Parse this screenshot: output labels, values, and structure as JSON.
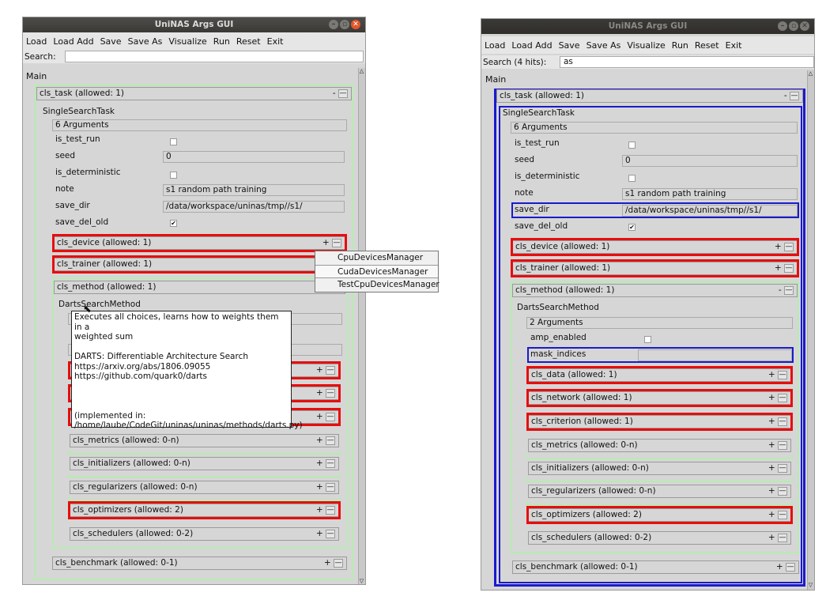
{
  "left": {
    "title": "UniNAS Args GUI",
    "menu": [
      "Load",
      "Load Add",
      "Save",
      "Save As",
      "Visualize",
      "Run",
      "Reset",
      "Exit"
    ],
    "search_label": "Search:",
    "search_value": "",
    "main_label": "Main",
    "cls_task": "cls_task (allowed: 1)",
    "task_name": "SingleSearchTask",
    "args_count": "6 Arguments",
    "args": [
      {
        "name": "is_test_run",
        "value": "",
        "type": "check",
        "checked": false
      },
      {
        "name": "seed",
        "value": "0",
        "type": "text"
      },
      {
        "name": "is_deterministic",
        "value": "",
        "type": "check",
        "checked": false
      },
      {
        "name": "note",
        "value": "s1 random path training",
        "type": "text"
      },
      {
        "name": "save_dir",
        "value": "/data/workspace/uninas/tmp//s1/",
        "type": "text"
      },
      {
        "name": "save_del_old",
        "value": "✔",
        "type": "check",
        "checked": true
      }
    ],
    "cls_device": "cls_device (allowed: 1)",
    "cls_trainer": "cls_trainer (allowed: 1)",
    "cls_method": "cls_method (allowed: 1)",
    "method_name": "DartsSearchMethod",
    "sub": [
      "cls_metrics (allowed: 0-n)",
      "cls_initializers (allowed: 0-n)",
      "cls_regularizers (allowed: 0-n)",
      "cls_optimizers (allowed: 2)",
      "cls_schedulers (allowed: 0-2)"
    ],
    "cls_benchmark": "cls_benchmark (allowed: 0-1)",
    "dropdown": [
      "CpuDevicesManager",
      "CudaDevicesManager",
      "TestCpuDevicesManager"
    ],
    "tooltip": [
      "Executes all choices, learns how to weights them in a",
      "weighted sum",
      "",
      "DARTS: Differentiable Architecture Search",
      "https://arxiv.org/abs/1806.09055",
      "https://github.com/quark0/darts",
      "",
      "",
      "",
      "(implemented in:",
      "/home/laube/CodeGit/uninas/uninas/methods/darts.py)"
    ],
    "plus": "+",
    "minus": "-"
  },
  "right": {
    "title": "UniNAS Args GUI",
    "menu": [
      "Load",
      "Load Add",
      "Save",
      "Save As",
      "Visualize",
      "Run",
      "Reset",
      "Exit"
    ],
    "search_label": "Search (4 hits):",
    "search_value": "as",
    "main_label": "Main",
    "cls_task": "cls_task (allowed: 1)",
    "task_name": "SingleSearchTask",
    "args_count": "6 Arguments",
    "args": [
      {
        "name": "is_test_run",
        "value": "",
        "type": "check",
        "checked": false
      },
      {
        "name": "seed",
        "value": "0",
        "type": "text"
      },
      {
        "name": "is_deterministic",
        "value": "",
        "type": "check",
        "checked": false
      },
      {
        "name": "note",
        "value": "s1 random path training",
        "type": "text"
      },
      {
        "name": "save_dir",
        "value": "/data/workspace/uninas/tmp//s1/",
        "type": "text"
      },
      {
        "name": "save_del_old",
        "value": "✔",
        "type": "check",
        "checked": true
      }
    ],
    "cls_device": "cls_device (allowed: 1)",
    "cls_trainer": "cls_trainer (allowed: 1)",
    "cls_method": "cls_method (allowed: 1)",
    "method_name": "DartsSearchMethod",
    "method_args_count": "2 Arguments",
    "method_args": [
      {
        "name": "amp_enabled",
        "type": "check",
        "checked": false
      },
      {
        "name": "mask_indices",
        "type": "text",
        "value": ""
      }
    ],
    "sub": [
      "cls_data (allowed: 1)",
      "cls_network (allowed: 1)",
      "cls_criterion (allowed: 1)",
      "cls_metrics (allowed: 0-n)",
      "cls_initializers (allowed: 0-n)",
      "cls_regularizers (allowed: 0-n)",
      "cls_optimizers (allowed: 2)",
      "cls_schedulers (allowed: 0-2)"
    ],
    "cls_benchmark": "cls_benchmark (allowed: 0-1)",
    "plus": "+",
    "minus": "-"
  }
}
